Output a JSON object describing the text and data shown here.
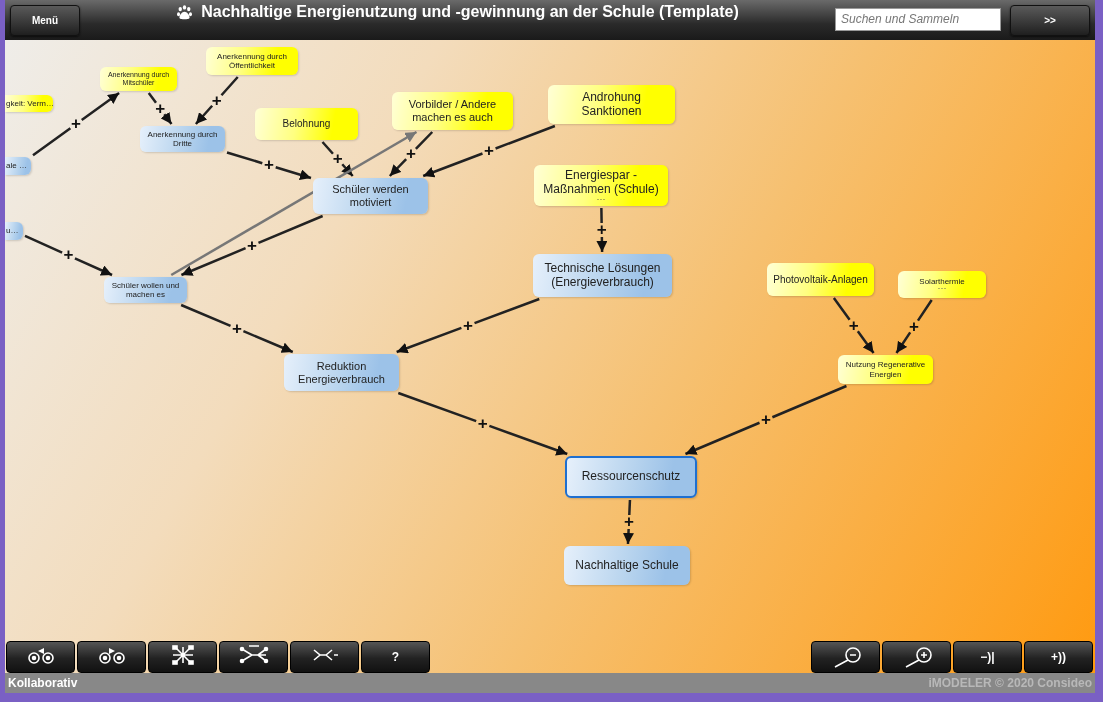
{
  "header": {
    "menu_button": "Menü",
    "title": "Nachhaltige Energienutzung und -gewinnung an der Schule (Template)",
    "search": {
      "placeholder": "Suchen und Sammeln"
    },
    "next_button": ">>"
  },
  "diagram": {
    "nodes": [
      {
        "label": "Anerkennung durch Mitschüler",
        "kind": "cause",
        "selected": false
      },
      {
        "label": "Anerkennung durch Öffentlichkeit",
        "kind": "cause",
        "selected": false
      },
      {
        "label": "gkeit: Verm…",
        "kind": "cause",
        "selected": false
      },
      {
        "label": "Belohnung",
        "kind": "cause",
        "selected": false
      },
      {
        "label": "Vorbilder / Andere machen es auch",
        "kind": "cause",
        "selected": false
      },
      {
        "label": "Androhung Sanktionen",
        "kind": "cause",
        "selected": false
      },
      {
        "label": "Anerkennung durch Dritte",
        "kind": "effect",
        "selected": false
      },
      {
        "label": "ale …",
        "kind": "effect",
        "selected": false
      },
      {
        "label": "Schüler werden motiviert",
        "kind": "effect",
        "selected": false
      },
      {
        "label": "Energiespar - Maßnahmen (Schule)",
        "kind": "cause",
        "selected": false,
        "more": "···"
      },
      {
        "label": "u…",
        "kind": "effect",
        "selected": false
      },
      {
        "label": "Schüler wollen und machen es",
        "kind": "effect",
        "selected": false
      },
      {
        "label": "Technische Lösungen (Energieverbrauch)",
        "kind": "effect",
        "selected": false
      },
      {
        "label": "Photovoltaik-Anlagen",
        "kind": "cause",
        "selected": false
      },
      {
        "label": "Solarthermie",
        "kind": "cause",
        "selected": false,
        "more": "···"
      },
      {
        "label": "Reduktion Energieverbrauch",
        "kind": "effect",
        "selected": false
      },
      {
        "label": "Nutzung Regenerative Energien",
        "kind": "cause",
        "selected": false
      },
      {
        "label": "Ressourcenschutz",
        "kind": "effect",
        "selected": true
      },
      {
        "label": "Nachhaltige Schule",
        "kind": "effect",
        "selected": false
      }
    ],
    "edges": [
      {
        "kind": "influence",
        "sign": "+"
      },
      {
        "kind": "influence",
        "sign": "+"
      },
      {
        "kind": "influence",
        "sign": "+"
      },
      {
        "kind": "influence",
        "sign": "+"
      },
      {
        "kind": "influence",
        "sign": "+"
      },
      {
        "kind": "influence",
        "sign": "+"
      },
      {
        "kind": "influence",
        "sign": "+"
      },
      {
        "kind": "influence",
        "sign": "+"
      },
      {
        "kind": "link"
      },
      {
        "kind": "influence",
        "sign": "+"
      },
      {
        "kind": "influence",
        "sign": "+"
      },
      {
        "kind": "influence",
        "sign": "+"
      },
      {
        "kind": "influence",
        "sign": "+"
      },
      {
        "kind": "influence",
        "sign": "+"
      },
      {
        "kind": "influence",
        "sign": "+"
      },
      {
        "kind": "influence",
        "sign": "+"
      },
      {
        "kind": "influence",
        "sign": "+"
      },
      {
        "kind": "influence",
        "sign": "+"
      }
    ]
  },
  "toolbar": {
    "left": [
      {
        "kind": "back"
      },
      {
        "kind": "forward"
      },
      {
        "kind": "tree"
      },
      {
        "kind": "network"
      },
      {
        "kind": "collapse"
      },
      {
        "kind": "text",
        "label": "?"
      }
    ],
    "right": [
      {
        "kind": "zoom-out"
      },
      {
        "kind": "zoom-in"
      },
      {
        "kind": "text",
        "label": "−)|"
      },
      {
        "kind": "text",
        "label": "+))"
      }
    ]
  },
  "status_bar": {
    "mode": "Kollaborativ",
    "copyright": "iMODELER © 2020 Consideo"
  }
}
